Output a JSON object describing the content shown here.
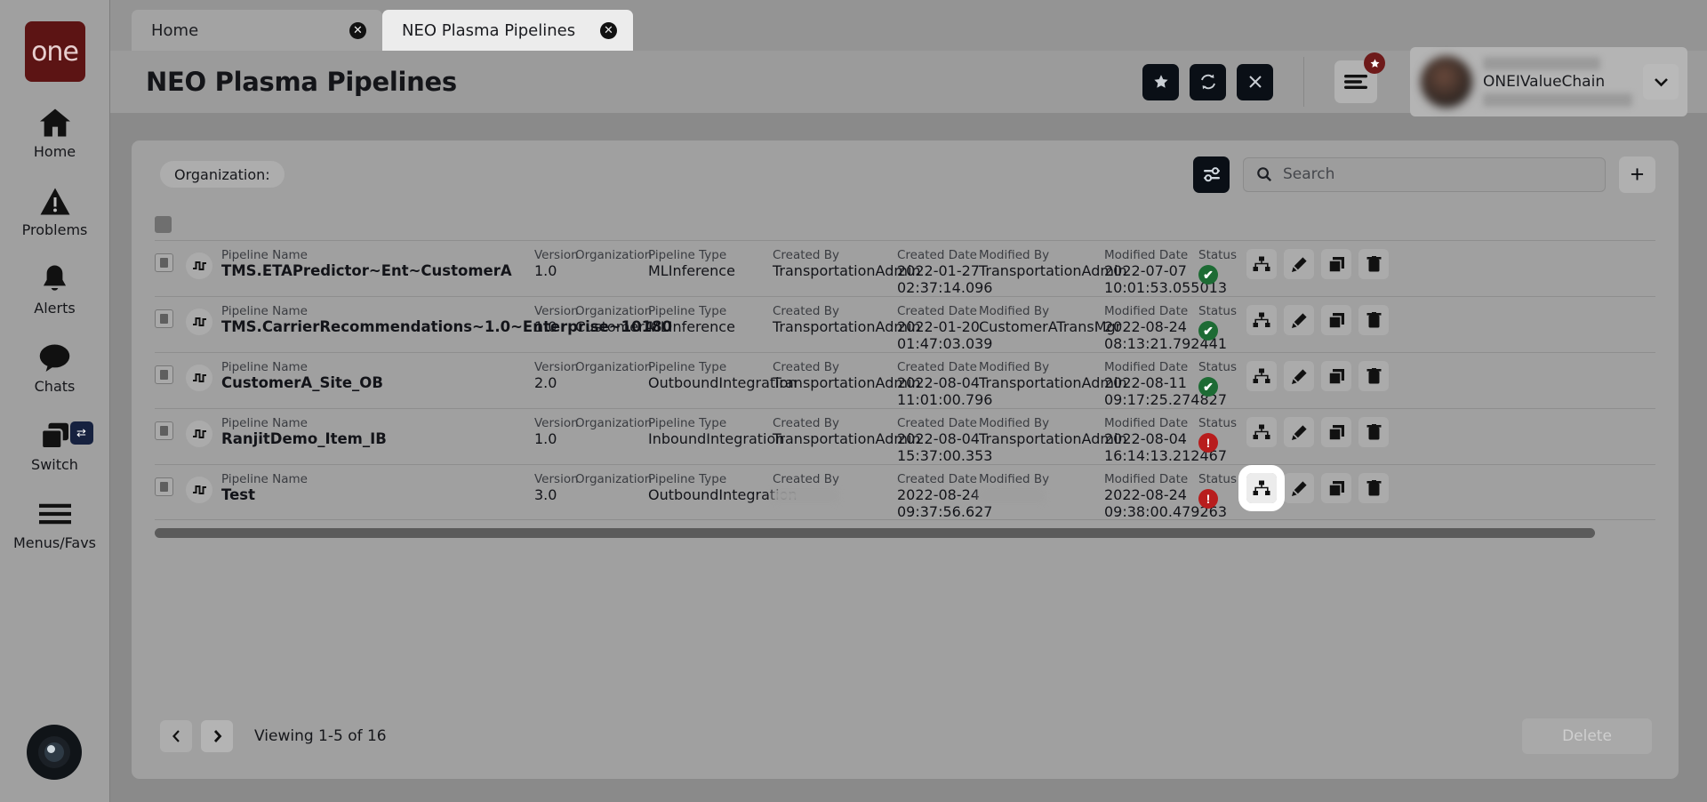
{
  "brand": {
    "logo_text": "one",
    "logo_color": "#5c1414"
  },
  "sidebar": {
    "items": [
      {
        "label": "Home",
        "icon": "home-icon"
      },
      {
        "label": "Problems",
        "icon": "warning-triangle-icon"
      },
      {
        "label": "Alerts",
        "icon": "bell-icon"
      },
      {
        "label": "Chats",
        "icon": "chat-bubble-icon"
      },
      {
        "label": "Switch",
        "icon": "switch-windows-icon",
        "badge_icon": "swap-arrows-icon"
      },
      {
        "label": "Menus/Favs",
        "icon": "hamburger-icon"
      }
    ]
  },
  "tabs": [
    {
      "label": "Home",
      "active": false,
      "close_icon": "close-icon"
    },
    {
      "label": "NEO Plasma Pipelines",
      "active": true,
      "close_icon": "close-icon"
    }
  ],
  "header": {
    "title": "NEO Plasma Pipelines",
    "actions": [
      {
        "name": "favorite-button",
        "icon": "star-icon"
      },
      {
        "name": "refresh-button",
        "icon": "refresh-icon"
      },
      {
        "name": "close-button",
        "icon": "x-icon"
      }
    ],
    "menus_button": {
      "icon": "menu-lines-icon",
      "badge_icon": "star-icon"
    },
    "user": {
      "org": "ONEIValueChain",
      "name_hidden": "",
      "subtitle_hidden": "",
      "caret_icon": "chevron-down-icon"
    }
  },
  "toolbar": {
    "organization_chip": "Organization:",
    "filter_icon": "sliders-icon",
    "search": {
      "placeholder": "Search",
      "value": "",
      "icon": "search-icon"
    },
    "add_label": "+"
  },
  "table": {
    "columns": {
      "name": "Pipeline Name",
      "version": "Version",
      "organization": "Organization",
      "type": "Pipeline Type",
      "created_by": "Created By",
      "created_date": "Created Date",
      "modified_by": "Modified By",
      "modified_date": "Modified Date",
      "status": "Status"
    },
    "row_actions": [
      {
        "name": "view-flow-button",
        "icon": "hierarchy-icon"
      },
      {
        "name": "edit-button",
        "icon": "pencil-icon"
      },
      {
        "name": "copy-button",
        "icon": "copy-icon"
      },
      {
        "name": "delete-row-button",
        "icon": "trash-icon"
      }
    ],
    "rows": [
      {
        "name": "TMS.ETAPredictor~Ent~CustomerA",
        "version": "1.0",
        "organization": "",
        "type": "MLInference",
        "created_by": "TransportationAdmin",
        "created_date": "2022-01-27",
        "created_time": "02:37:14.096",
        "modified_by": "TransportationAdmin",
        "modified_date": "2022-07-07",
        "modified_time": "10:01:53.055013",
        "status": "ok",
        "focused_action": false,
        "created_by_hidden": false,
        "modified_by_hidden": false
      },
      {
        "name": "TMS.CarrierRecommendations~1.0~Enterprise~10180",
        "version": "1.0",
        "organization": "CustomerA",
        "type": "MLInference",
        "created_by": "TransportationAdmin",
        "created_date": "2022-01-20",
        "created_time": "01:47:03.039",
        "modified_by": "CustomerATransMgr",
        "modified_date": "2022-08-24",
        "modified_time": "08:13:21.792441",
        "status": "ok",
        "focused_action": false,
        "created_by_hidden": false,
        "modified_by_hidden": false
      },
      {
        "name": "CustomerA_Site_OB",
        "version": "2.0",
        "organization": "",
        "type": "OutboundIntegration",
        "created_by": "TransportationAdmin",
        "created_date": "2022-08-04",
        "created_time": "11:01:00.796",
        "modified_by": "TransportationAdmin",
        "modified_date": "2022-08-11",
        "modified_time": "09:17:25.274827",
        "status": "ok",
        "focused_action": false,
        "created_by_hidden": false,
        "modified_by_hidden": false
      },
      {
        "name": "RanjitDemo_Item_IB",
        "version": "1.0",
        "organization": "",
        "type": "InboundIntegration",
        "created_by": "TransportationAdmin",
        "created_date": "2022-08-04",
        "created_time": "15:37:00.353",
        "modified_by": "TransportationAdmin",
        "modified_date": "2022-08-04",
        "modified_time": "16:14:13.212467",
        "status": "error",
        "focused_action": false,
        "created_by_hidden": false,
        "modified_by_hidden": false
      },
      {
        "name": "Test",
        "version": "3.0",
        "organization": "",
        "type": "OutboundIntegration",
        "created_by": "",
        "created_date": "2022-08-24",
        "created_time": "09:37:56.627",
        "modified_by": "",
        "modified_date": "2022-08-24",
        "modified_time": "09:38:00.479263",
        "status": "error",
        "focused_action": true,
        "created_by_hidden": true,
        "modified_by_hidden": true
      }
    ]
  },
  "footer": {
    "prev_icon": "chevron-left-icon",
    "next_icon": "chevron-right-icon",
    "viewing": "Viewing 1-5 of 16",
    "delete_label": "Delete"
  },
  "colors": {
    "brand_dark_red": "#5c1414",
    "status_ok": "#1d6b34",
    "status_error": "#b81d1d",
    "dark_button": "#0a0f16"
  }
}
